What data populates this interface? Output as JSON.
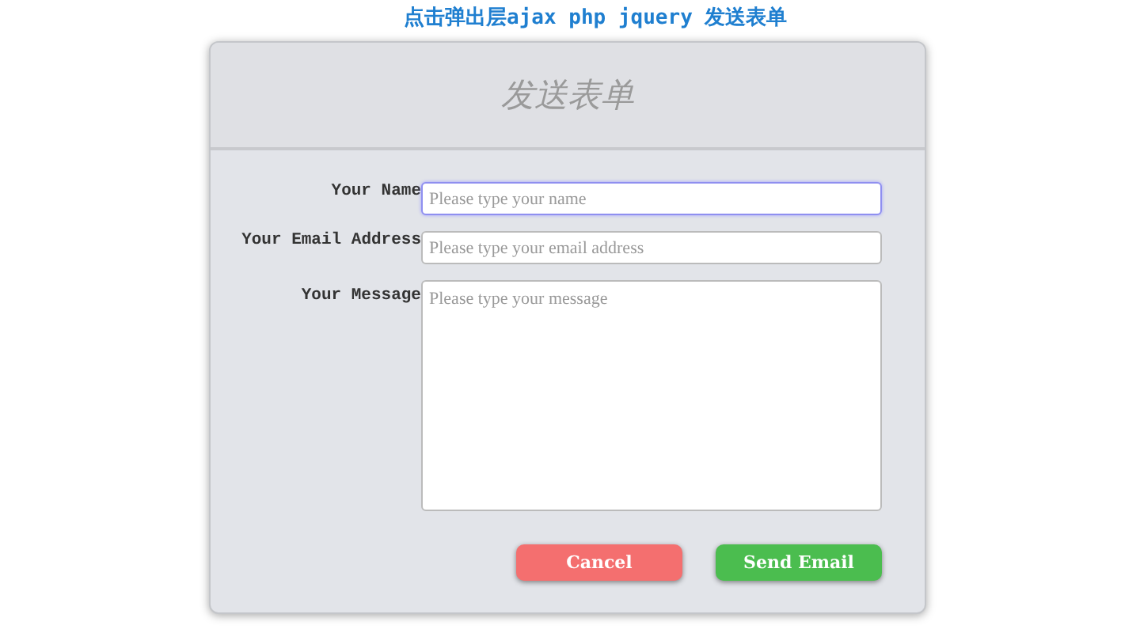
{
  "page_title": "点击弹出层ajax php jquery 发送表单",
  "dialog": {
    "title": "发送表单",
    "fields": [
      {
        "kind": "input",
        "label": "Your Name",
        "placeholder": "Please type your name",
        "focused": true
      },
      {
        "kind": "input",
        "label": "Your Email Address",
        "placeholder": "Please type your email address",
        "focused": false
      },
      {
        "kind": "textarea",
        "label": "Your Message",
        "placeholder": "Please type your message",
        "focused": false
      }
    ],
    "buttons": [
      {
        "kind": "cancel",
        "label": "Cancel"
      },
      {
        "kind": "submit",
        "label": "Send Email"
      }
    ]
  }
}
